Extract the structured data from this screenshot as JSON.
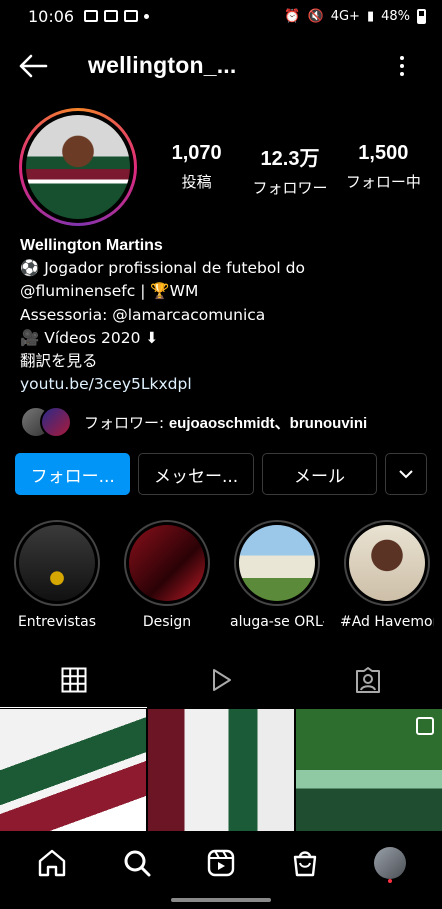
{
  "status_bar": {
    "time": "10:06",
    "network": "4G+",
    "battery": "48%"
  },
  "topbar": {
    "username": "wellington_..."
  },
  "stats": [
    {
      "value": "1,070",
      "label": "投稿"
    },
    {
      "value": "12.3万",
      "label": "フォロワー"
    },
    {
      "value": "1,500",
      "label": "フォロー中"
    }
  ],
  "bio": {
    "name": "Wellington Martins",
    "line1": "⚽ Jogador profissional de futebol do",
    "line2": "@fluminensefc | 🏆WM",
    "line3": "Assessoria: @lamarcacomunica",
    "line4": "🎥 Vídeos 2020 ⬇",
    "translate": "翻訳を見る",
    "link": "youtu.be/3cey5Lkxdpl"
  },
  "followed_by": {
    "prefix": "フォロワー: ",
    "names": "eujoaoschmidt、brunouvini"
  },
  "buttons": {
    "follow": "フォロー...",
    "message": "メッセー...",
    "email": "メール"
  },
  "highlights": [
    {
      "label": "Entrevistas"
    },
    {
      "label": "Design"
    },
    {
      "label": "aluga-se ORL-..."
    },
    {
      "label": "#Ad Havemon..."
    }
  ],
  "tabs": [
    "grid-icon",
    "reels-icon",
    "tagged-icon"
  ],
  "nav": [
    "home-icon",
    "search-icon",
    "reels-icon",
    "shop-icon",
    "profile-avatar"
  ]
}
